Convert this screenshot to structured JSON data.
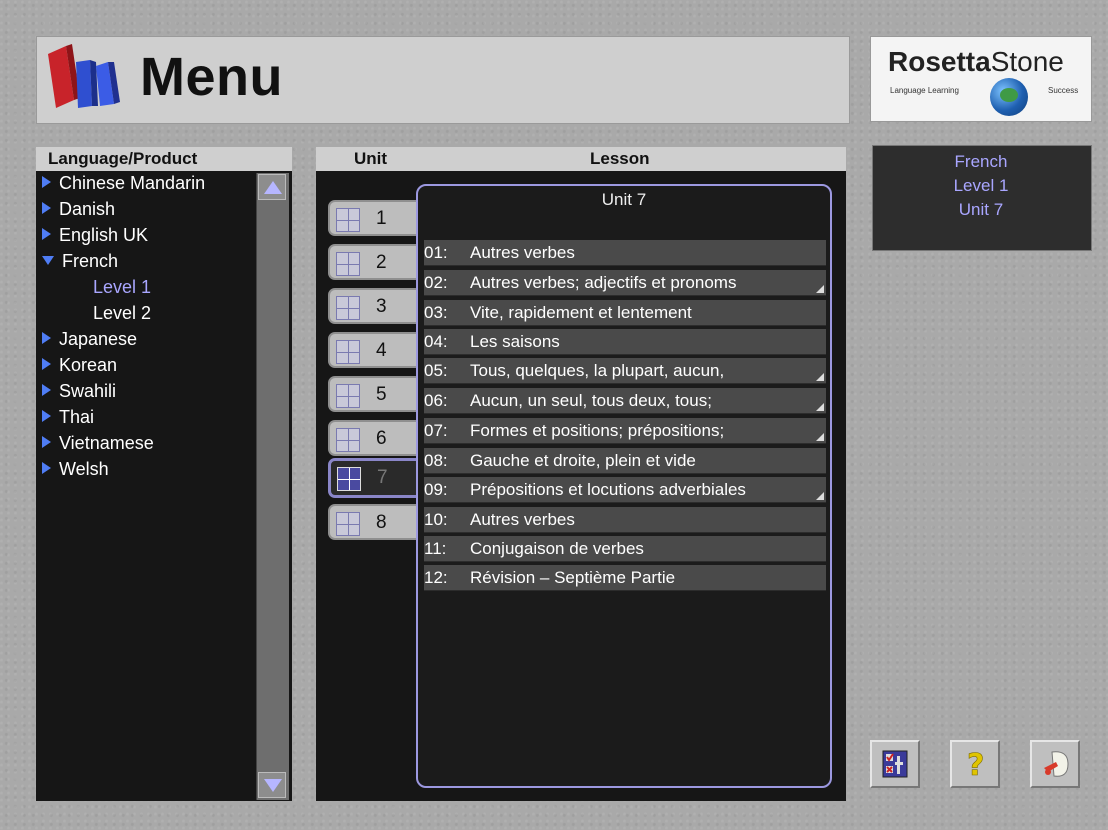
{
  "header": {
    "title": "Menu"
  },
  "logo": {
    "brand_bold": "Rosetta",
    "brand_light": "Stone",
    "tag_left": "Language Learning",
    "tag_right": "Success"
  },
  "language_panel": {
    "header": "Language/Product",
    "items": [
      {
        "label": "Chinese Mandarin"
      },
      {
        "label": "Danish"
      },
      {
        "label": "English UK"
      },
      {
        "label": "French"
      },
      {
        "label": "Japanese"
      },
      {
        "label": "Korean"
      },
      {
        "label": "Swahili"
      },
      {
        "label": "Thai"
      },
      {
        "label": "Vietnamese"
      },
      {
        "label": "Welsh"
      }
    ],
    "french_levels": [
      {
        "label": "Level 1",
        "selected": true
      },
      {
        "label": "Level 2",
        "selected": false
      }
    ]
  },
  "unit_lesson": {
    "unit_header": "Unit",
    "lesson_header": "Lesson",
    "units": [
      "1",
      "2",
      "3",
      "4",
      "5",
      "6",
      "7",
      "8"
    ],
    "active_unit": "7",
    "lesson_box_title": "Unit 7",
    "lessons": [
      {
        "num": "01:",
        "title": "Autres verbes"
      },
      {
        "num": "02:",
        "title": "Autres verbes; adjectifs et pronoms"
      },
      {
        "num": "03:",
        "title": "Vite, rapidement et lentement"
      },
      {
        "num": "04:",
        "title": "Les saisons"
      },
      {
        "num": "05:",
        "title": "Tous, quelques, la plupart, aucun,"
      },
      {
        "num": "06:",
        "title": "Aucun, un seul, tous deux, tous;"
      },
      {
        "num": "07:",
        "title": "Formes et positions; prépositions;"
      },
      {
        "num": "08:",
        "title": "Gauche et droite, plein et vide"
      },
      {
        "num": "09:",
        "title": "Prépositions et locutions adverbiales"
      },
      {
        "num": "10:",
        "title": "Autres verbes"
      },
      {
        "num": "11:",
        "title": "Conjugaison de verbes"
      },
      {
        "num": "12:",
        "title": "Révision – Septième Partie"
      }
    ]
  },
  "info_panel": {
    "line1": "French",
    "line2": "Level 1",
    "line3": "Unit 7"
  },
  "colors": {
    "accent_blue": "#4f7df5",
    "selection_lavender": "#a9a6ff",
    "panel_dark": "#161616"
  }
}
